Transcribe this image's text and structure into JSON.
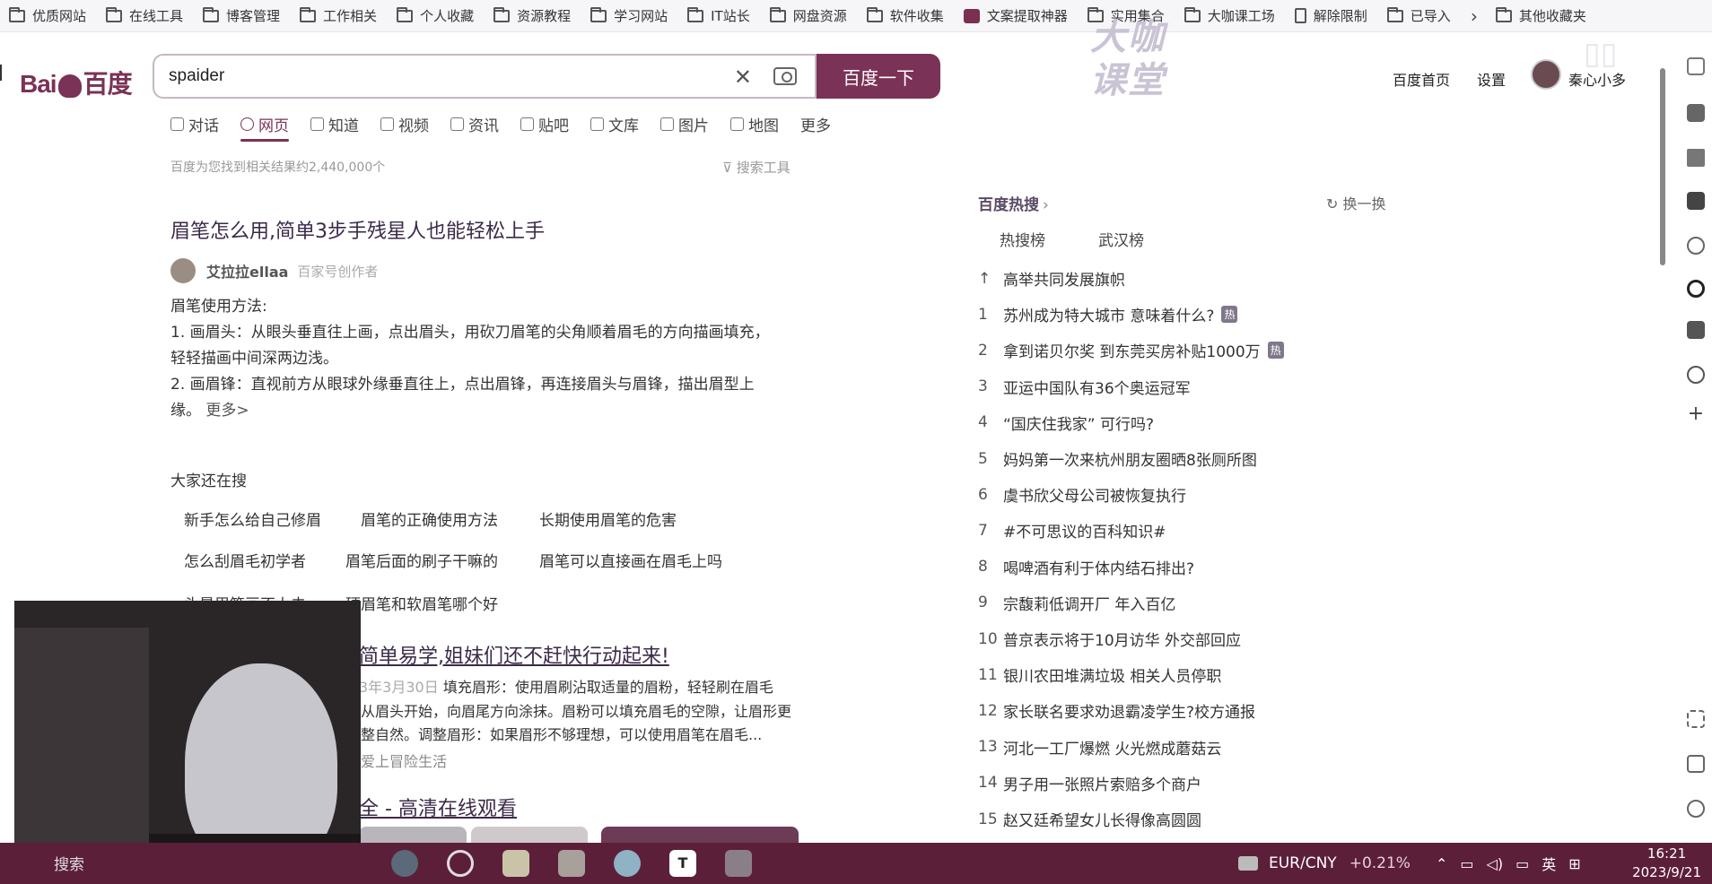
{
  "bookmarks": [
    {
      "label": "优质网站",
      "icon": "folder-icon"
    },
    {
      "label": "在线工具",
      "icon": "folder-icon"
    },
    {
      "label": "博客管理",
      "icon": "folder-icon"
    },
    {
      "label": "工作相关",
      "icon": "folder-icon"
    },
    {
      "label": "个人收藏",
      "icon": "folder-icon"
    },
    {
      "label": "资源教程",
      "icon": "folder-icon"
    },
    {
      "label": "学习网站",
      "icon": "folder-icon"
    },
    {
      "label": "IT站长",
      "icon": "folder-icon"
    },
    {
      "label": "网盘资源",
      "icon": "folder-icon"
    },
    {
      "label": "软件收集",
      "icon": "folder-icon"
    },
    {
      "label": "文案提取神器",
      "icon": "app-icon"
    },
    {
      "label": "实用集合",
      "icon": "folder-icon"
    },
    {
      "label": "大咖课工场",
      "icon": "folder-icon"
    },
    {
      "label": "解除限制",
      "icon": "document-icon"
    },
    {
      "label": "已导入",
      "icon": "folder-icon"
    }
  ],
  "bookmarks_other": "其他收藏夹",
  "header": {
    "logo_text_left": "Bai",
    "logo_text_right": "百度",
    "search_value": "spaider",
    "search_button": "百度一下",
    "home_link": "百度首页",
    "settings_link": "设置",
    "username": "秦心小多",
    "watermark_line1": "大咖",
    "watermark_line2": "课堂"
  },
  "tabs": [
    {
      "label": "对话",
      "active": false
    },
    {
      "label": "网页",
      "active": true
    },
    {
      "label": "知道",
      "active": false
    },
    {
      "label": "视频",
      "active": false
    },
    {
      "label": "资讯",
      "active": false
    },
    {
      "label": "贴吧",
      "active": false
    },
    {
      "label": "文库",
      "active": false
    },
    {
      "label": "图片",
      "active": false
    },
    {
      "label": "地图",
      "active": false
    },
    {
      "label": "更多",
      "active": false
    }
  ],
  "result_count": "百度为您找到相关结果约2,440,000个",
  "search_tools": "搜索工具",
  "result1": {
    "title": "眉笔怎么用,简单3步手残星人也能轻松上手",
    "author": "艾拉拉ellaa",
    "author_tag": "百家号创作者",
    "line1": "眉笔使用方法:",
    "line2": "1. 画眉头：从眼头垂直往上画，点出眉头，用砍刀眉笔的尖角顺着眉毛的方向描画填充，",
    "line3": "轻轻描画中间深两边浅。",
    "line4": "2. 画眉锋：直视前方从眼球外缘垂直往上，点出眉锋，再连接眉头与眉锋，描出眉型上",
    "line5": "缘。",
    "more": "更多>"
  },
  "also_search": {
    "title": "大家还在搜",
    "items": [
      "新手怎么给自己修眉",
      "眉笔的正确使用方法",
      "长期使用眉笔的危害",
      "怎么刮眉毛初学者",
      "眉笔后面的刷子干嘛的",
      "眉笔可以直接画在眉毛上吗",
      "头晕眉笔画不上去",
      "硬眉笔和软眉笔哪个好"
    ]
  },
  "result2": {
    "title": "简单易学,姐妹们还不赶快行动起来!",
    "date": "3年3月30日",
    "line1": "填充眉形：使用眉刷沾取适量的眉粉，轻轻刷在眉毛",
    "line2": "从眉头开始，向眉尾方向涂抹。眉粉可以填充眉毛的空隙，让眉形更",
    "line3": "整自然。调整眉形：如果眉形不够理想，可以使用眉笔在眉毛...",
    "source": "爱上冒险生活"
  },
  "result3": {
    "title": "全 - 高清在线观看"
  },
  "hot": {
    "title": "百度热搜",
    "refresh": "换一换",
    "tabs": [
      "热搜榜",
      "武汉榜"
    ],
    "items": [
      {
        "rank": "↑",
        "text": "高举共同发展旗帜",
        "badge": ""
      },
      {
        "rank": "1",
        "text": "苏州成为特大城市 意味着什么?",
        "badge": "热"
      },
      {
        "rank": "2",
        "text": "拿到诺贝尔奖 到东莞买房补贴1000万",
        "badge": "热"
      },
      {
        "rank": "3",
        "text": "亚运中国队有36个奥运冠军",
        "badge": ""
      },
      {
        "rank": "4",
        "text": "“国庆住我家” 可行吗?",
        "badge": ""
      },
      {
        "rank": "5",
        "text": "妈妈第一次来杭州朋友圈晒8张厕所图",
        "badge": ""
      },
      {
        "rank": "6",
        "text": "虞书欣父母公司被恢复执行",
        "badge": ""
      },
      {
        "rank": "7",
        "text": "#不可思议的百科知识#",
        "badge": ""
      },
      {
        "rank": "8",
        "text": "喝啤酒有利于体内结石排出?",
        "badge": ""
      },
      {
        "rank": "9",
        "text": "宗馥莉低调开厂 年入百亿",
        "badge": ""
      },
      {
        "rank": "10",
        "text": "普京表示将于10月访华 外交部回应",
        "badge": ""
      },
      {
        "rank": "11",
        "text": "银川农田堆满垃圾 相关人员停职",
        "badge": ""
      },
      {
        "rank": "12",
        "text": "家长联名要求劝退霸凌学生?校方通报",
        "badge": ""
      },
      {
        "rank": "13",
        "text": "河北一工厂爆燃 火光燃成蘑菇云",
        "badge": ""
      },
      {
        "rank": "14",
        "text": "男子用一张照片索赔多个商户",
        "badge": ""
      },
      {
        "rank": "15",
        "text": "赵又廷希望女儿长得像高圆圆",
        "badge": ""
      }
    ]
  },
  "taskbar": {
    "search_label": "搜索",
    "currency": "EUR/CNY",
    "change": "+0.21%",
    "lang": "英",
    "time": "16:21",
    "date": "2023/9/21"
  }
}
